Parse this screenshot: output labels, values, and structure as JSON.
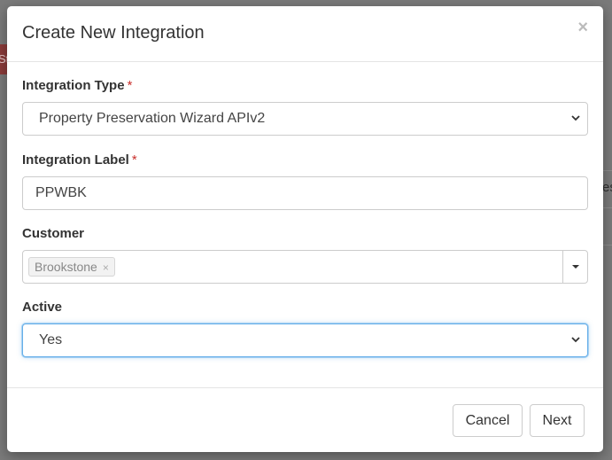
{
  "background": {
    "left_button_text": "Ste",
    "right_fragment_text": "es"
  },
  "modal": {
    "title": "Create New Integration",
    "close_glyph": "×"
  },
  "fields": {
    "integration_type": {
      "label": "Integration Type",
      "required_mark": "*",
      "value": "Property Preservation Wizard APIv2"
    },
    "integration_label": {
      "label": "Integration Label",
      "required_mark": "*",
      "value": "PPWBK"
    },
    "customer": {
      "label": "Customer",
      "tags": [
        "Brookstone"
      ],
      "tag_remove_glyph": "×"
    },
    "active": {
      "label": "Active",
      "value": "Yes"
    }
  },
  "footer": {
    "cancel_label": "Cancel",
    "next_label": "Next"
  },
  "colors": {
    "required": "#c9302c",
    "focus_border": "#66afe9",
    "overlay": "#7a7a7a"
  }
}
